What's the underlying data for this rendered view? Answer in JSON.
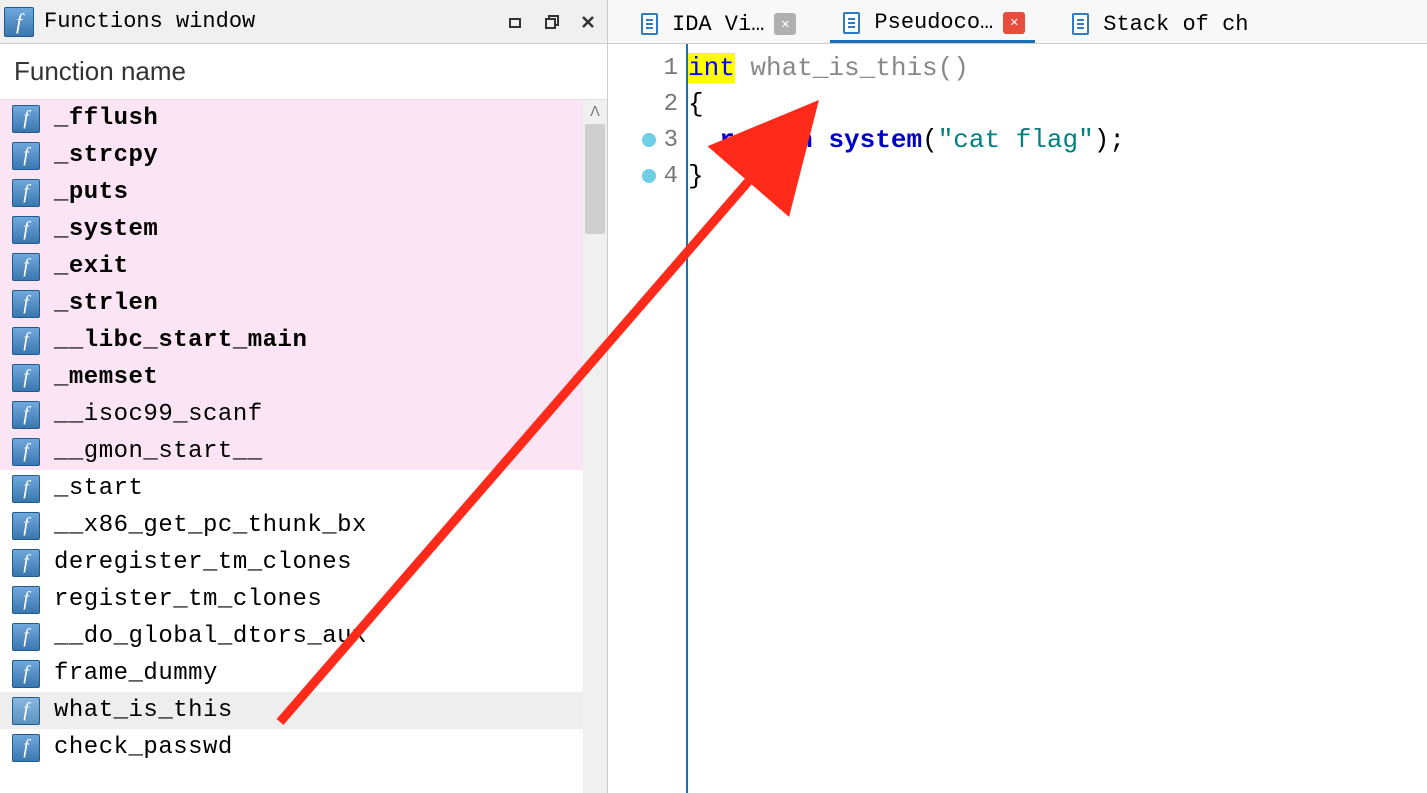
{
  "panel": {
    "title": "Functions window",
    "column_header": "Function name"
  },
  "functions": [
    {
      "name": "_fflush",
      "bold": true,
      "pink": true
    },
    {
      "name": "_strcpy",
      "bold": true,
      "pink": true
    },
    {
      "name": "_puts",
      "bold": true,
      "pink": true
    },
    {
      "name": "_system",
      "bold": true,
      "pink": true
    },
    {
      "name": "_exit",
      "bold": true,
      "pink": true
    },
    {
      "name": "_strlen",
      "bold": true,
      "pink": true
    },
    {
      "name": "__libc_start_main",
      "bold": true,
      "pink": true
    },
    {
      "name": "_memset",
      "bold": true,
      "pink": true
    },
    {
      "name": "__isoc99_scanf",
      "bold": false,
      "pink": true
    },
    {
      "name": "__gmon_start__",
      "bold": false,
      "pink": true
    },
    {
      "name": "_start",
      "bold": false,
      "pink": false
    },
    {
      "name": "__x86_get_pc_thunk_bx",
      "bold": false,
      "pink": false
    },
    {
      "name": "deregister_tm_clones",
      "bold": false,
      "pink": false
    },
    {
      "name": "register_tm_clones",
      "bold": false,
      "pink": false
    },
    {
      "name": "__do_global_dtors_aux",
      "bold": false,
      "pink": false
    },
    {
      "name": "frame_dummy",
      "bold": false,
      "pink": false
    },
    {
      "name": "what_is_this",
      "bold": false,
      "pink": false,
      "selected": true
    },
    {
      "name": "check_passwd",
      "bold": false,
      "pink": false
    }
  ],
  "tabs": [
    {
      "label": "IDA Vi…",
      "active": false,
      "close": "gray"
    },
    {
      "label": "Pseudoco…",
      "active": true,
      "close": "red"
    },
    {
      "label": "Stack of ch",
      "active": false,
      "close": null
    }
  ],
  "code": {
    "fn_name": "what_is_this",
    "type_kw": "int",
    "return_kw": "return",
    "call": "system",
    "arg": "\"cat flag\"",
    "lines": [
      "1",
      "2",
      "3",
      "4"
    ],
    "bp_lines": [
      3,
      4
    ]
  }
}
